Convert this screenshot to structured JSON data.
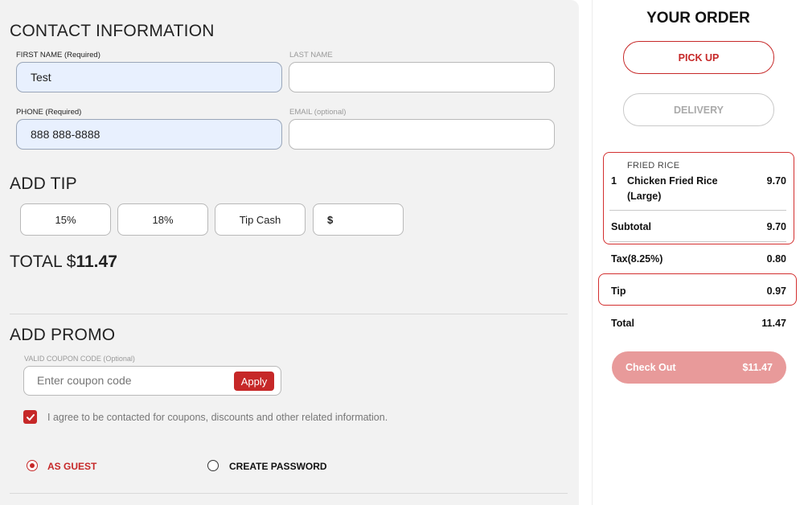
{
  "contact": {
    "title": "CONTACT INFORMATION",
    "first_name_label": "FIRST NAME (Required)",
    "first_name_value": "Test",
    "last_name_label": "LAST NAME",
    "last_name_value": "",
    "phone_label": "PHONE (Required)",
    "phone_value": "888 888-8888",
    "email_label": "EMAIL (optional)",
    "email_value": ""
  },
  "tip": {
    "title": "ADD TIP",
    "options": [
      "15%",
      "18%",
      "Tip Cash"
    ],
    "custom_prefix": "$"
  },
  "total": {
    "label": "TOTAL $",
    "value": "11.47"
  },
  "promo": {
    "title": "ADD PROMO",
    "coupon_label": "VALID COUPON CODE (Optional)",
    "coupon_placeholder": "Enter coupon code",
    "apply_label": "Apply",
    "consent_text": "I agree to be contacted for coupons, discounts and other related information.",
    "consent_checked": true
  },
  "account": {
    "guest_label": "AS GUEST",
    "create_label": "CREATE PASSWORD",
    "selected": "guest"
  },
  "order": {
    "title": "YOUR ORDER",
    "pickup_label": "PICK UP",
    "delivery_label": "DELIVERY",
    "selected_mode": "pickup",
    "category": "FRIED RICE",
    "item_qty": "1",
    "item_name_line1": "Chicken Fried Rice",
    "item_name_line2": "(Large)",
    "item_price": "9.70",
    "subtotal_label": "Subtotal",
    "subtotal_value": "9.70",
    "tax_label": "Tax(8.25%)",
    "tax_value": "0.80",
    "tip_label": "Tip",
    "tip_value": "0.97",
    "total_label": "Total",
    "total_value": "11.47",
    "checkout_label": "Check Out",
    "checkout_amount": "$11.47"
  },
  "colors": {
    "accent": "#c62828",
    "highlight_border": "#d32f2f",
    "checkout_bg": "#e89a9a",
    "autofill_bg": "#e8f0fe",
    "panel_bg": "#f2f2f2"
  }
}
